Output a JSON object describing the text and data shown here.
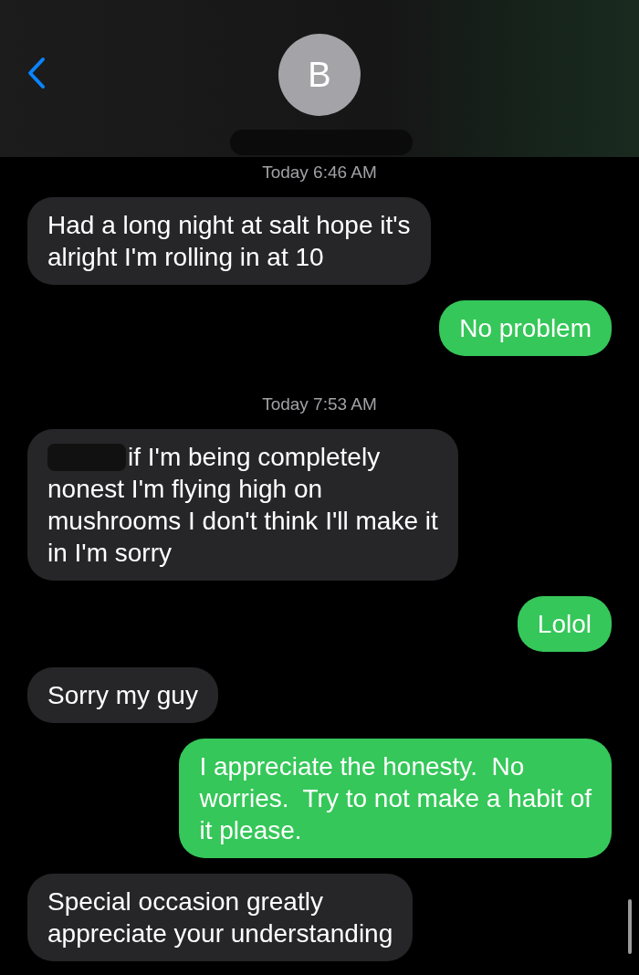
{
  "header": {
    "avatar_initial": "B",
    "name_redacted": true
  },
  "messages": [
    {
      "kind": "timestamp",
      "text": "Today 6:46 AM"
    },
    {
      "kind": "message",
      "sent": false,
      "text": "Had a long night at salt hope it's\nalright I'm rolling in at 10",
      "redacted_prefix": false
    },
    {
      "kind": "message",
      "sent": true,
      "text": "No problem"
    },
    {
      "kind": "timestamp",
      "text": "Today 7:53 AM"
    },
    {
      "kind": "message",
      "sent": false,
      "text": "if I'm being completely\nnonest I'm flying high on\nmushrooms I don't think I'll make it\nin I'm sorry",
      "redacted_prefix": true
    },
    {
      "kind": "message",
      "sent": true,
      "text": "Lolol"
    },
    {
      "kind": "message",
      "sent": false,
      "text": "Sorry my guy",
      "redacted_prefix": false
    },
    {
      "kind": "message",
      "sent": true,
      "text": "I appreciate the honesty.  No\nworries.  Try to not make a habit of\nit please."
    },
    {
      "kind": "message",
      "sent": false,
      "text": "Special occasion greatly\nappreciate your understanding",
      "redacted_prefix": false
    }
  ]
}
